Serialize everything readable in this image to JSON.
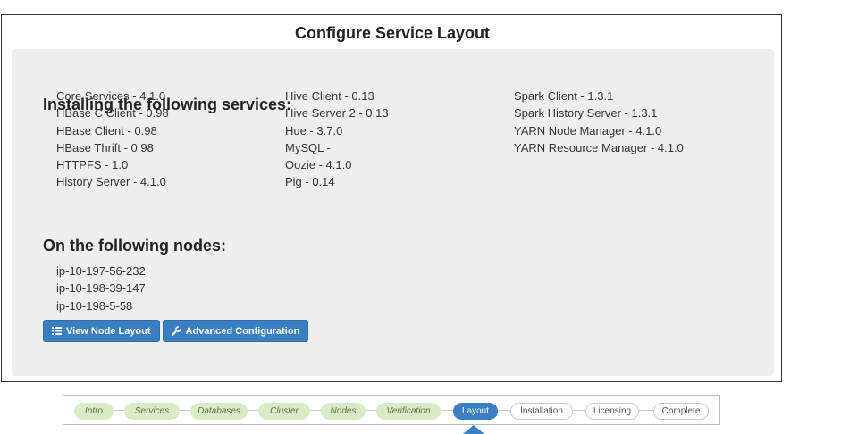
{
  "page": {
    "title": "Configure Service Layout"
  },
  "services": {
    "heading": "Installing the following services:",
    "columns": [
      [
        "Core Services - 4.1.0",
        "HBase C Client - 0.98",
        "HBase Client - 0.98",
        "HBase Thrift - 0.98",
        "HTTPFS - 1.0",
        "History Server - 4.1.0"
      ],
      [
        "Hive Client - 0.13",
        "Hive Server 2 - 0.13",
        "Hue - 3.7.0",
        "MySQL -",
        "Oozie - 4.1.0",
        "Pig - 0.14"
      ],
      [
        "Spark Client - 1.3.1",
        "Spark History Server - 1.3.1",
        "YARN Node Manager - 4.1.0",
        "YARN Resource Manager - 4.1.0"
      ]
    ]
  },
  "nodes": {
    "heading": "On the following nodes:",
    "items": [
      "ip-10-197-56-232",
      "ip-10-198-39-147",
      "ip-10-198-5-58"
    ]
  },
  "buttons": {
    "view_layout": {
      "label": "View Node Layout",
      "icon": "list-icon"
    },
    "advanced": {
      "label": "Advanced Configuration",
      "icon": "wrench-icon"
    }
  },
  "wizard": {
    "steps": [
      {
        "label": "Intro",
        "state": "done"
      },
      {
        "label": "Services",
        "state": "done"
      },
      {
        "label": "Databases",
        "state": "done"
      },
      {
        "label": "Cluster",
        "state": "done"
      },
      {
        "label": "Nodes",
        "state": "done"
      },
      {
        "label": "Verification",
        "state": "done"
      },
      {
        "label": "Layout",
        "state": "active"
      },
      {
        "label": "Installation",
        "state": "todo"
      },
      {
        "label": "Licensing",
        "state": "todo"
      },
      {
        "label": "Complete",
        "state": "todo"
      }
    ]
  },
  "colors": {
    "accent": "#3a7fc1",
    "panel": "#eeeeee",
    "step_done": "#d8ecc8"
  }
}
